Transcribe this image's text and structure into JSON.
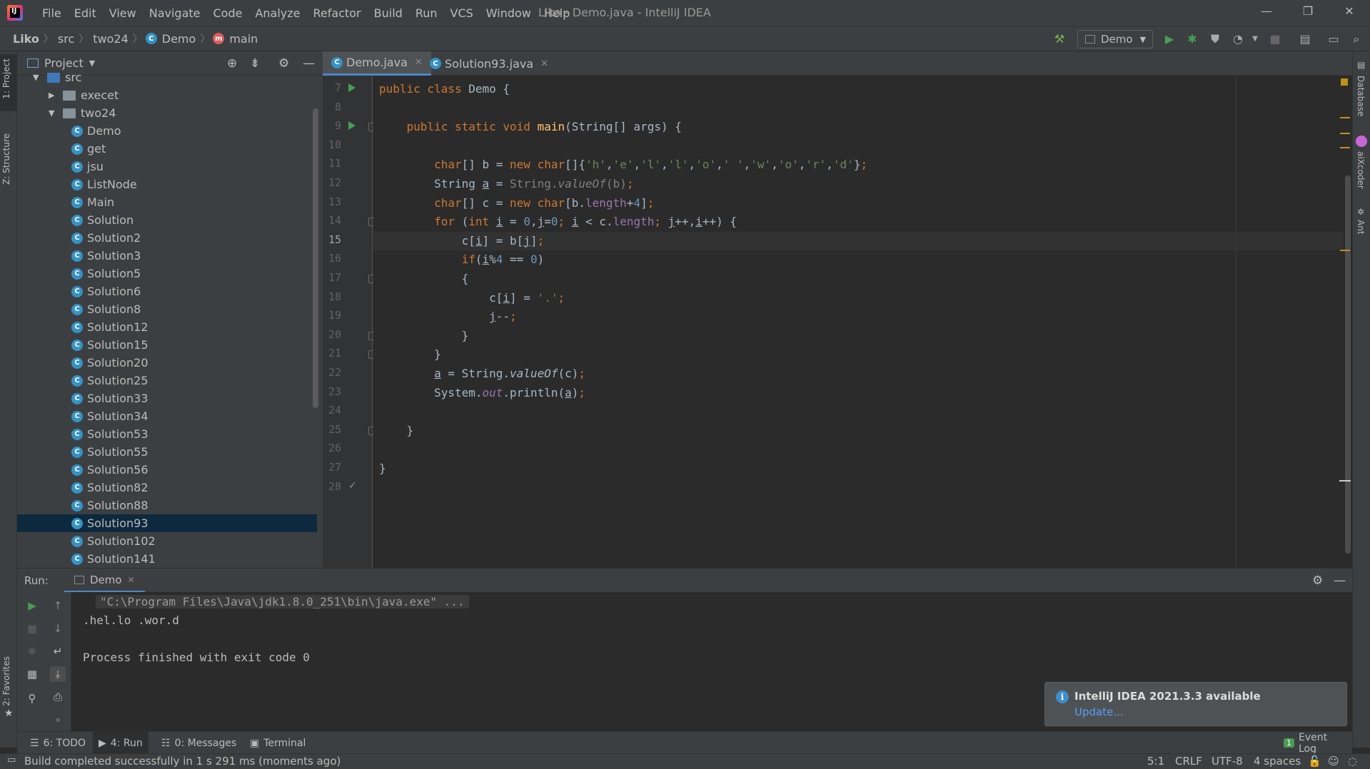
{
  "window": {
    "title": "Liko - Demo.java - IntelliJ IDEA",
    "menus": [
      "File",
      "Edit",
      "View",
      "Navigate",
      "Code",
      "Analyze",
      "Refactor",
      "Build",
      "Run",
      "VCS",
      "Window",
      "Help"
    ]
  },
  "breadcrumb": {
    "project": "Liko",
    "src": "src",
    "package": "two24",
    "class": "Demo",
    "method": "main"
  },
  "toolbar": {
    "run_config": "Demo"
  },
  "left_strip": {
    "project_tab": "1: Project",
    "structure_tab": "Z: Structure",
    "favorites_tab": "2: Favorites"
  },
  "right_strip": {
    "database_tab": "Database",
    "aixcoder_tab": "aiXcoder",
    "ant_tab": "Ant"
  },
  "project_panel": {
    "title": "Project",
    "tree": [
      {
        "label": "src",
        "kind": "src-folder",
        "depth": 0,
        "arrow": "▼"
      },
      {
        "label": "execet",
        "kind": "package",
        "depth": 1,
        "arrow": "▶"
      },
      {
        "label": "two24",
        "kind": "package",
        "depth": 1,
        "arrow": "▼"
      },
      {
        "label": "Demo",
        "kind": "class-main",
        "depth": 2
      },
      {
        "label": "get",
        "kind": "class-main",
        "depth": 2
      },
      {
        "label": "jsu",
        "kind": "class-main",
        "depth": 2
      },
      {
        "label": "ListNode",
        "kind": "class",
        "depth": 2
      },
      {
        "label": "Main",
        "kind": "class-main",
        "depth": 2
      },
      {
        "label": "Solution",
        "kind": "class",
        "depth": 2
      },
      {
        "label": "Solution2",
        "kind": "class",
        "depth": 2
      },
      {
        "label": "Solution3",
        "kind": "class",
        "depth": 2
      },
      {
        "label": "Solution5",
        "kind": "class",
        "depth": 2
      },
      {
        "label": "Solution6",
        "kind": "class",
        "depth": 2
      },
      {
        "label": "Solution8",
        "kind": "class",
        "depth": 2
      },
      {
        "label": "Solution12",
        "kind": "class",
        "depth": 2
      },
      {
        "label": "Solution15",
        "kind": "class",
        "depth": 2
      },
      {
        "label": "Solution20",
        "kind": "class",
        "depth": 2
      },
      {
        "label": "Solution25",
        "kind": "class",
        "depth": 2
      },
      {
        "label": "Solution33",
        "kind": "class",
        "depth": 2
      },
      {
        "label": "Solution34",
        "kind": "class",
        "depth": 2
      },
      {
        "label": "Solution53",
        "kind": "class",
        "depth": 2
      },
      {
        "label": "Solution55",
        "kind": "class",
        "depth": 2
      },
      {
        "label": "Solution56",
        "kind": "class",
        "depth": 2
      },
      {
        "label": "Solution82",
        "kind": "class",
        "depth": 2
      },
      {
        "label": "Solution88",
        "kind": "class",
        "depth": 2
      },
      {
        "label": "Solution93",
        "kind": "class",
        "depth": 2,
        "selected": true
      },
      {
        "label": "Solution102",
        "kind": "class",
        "depth": 2
      },
      {
        "label": "Solution141",
        "kind": "class",
        "depth": 2
      }
    ]
  },
  "editor": {
    "tabs": [
      {
        "label": "Demo.java",
        "active": true
      },
      {
        "label": "Solution93.java",
        "active": false
      }
    ],
    "current_line": 15,
    "lines": [
      {
        "n": "7",
        "html": "<span class=\"kw\">public class </span>Demo {"
      },
      {
        "n": "8",
        "html": ""
      },
      {
        "n": "9",
        "html": "    <span class=\"kw\">public static void </span><span class=\"fn\">main</span>(String[] args) {"
      },
      {
        "n": "10",
        "html": ""
      },
      {
        "n": "11",
        "html": "        <span class=\"kw\">char</span>[] b = <span class=\"kw\">new char</span>[]{<span class=\"str\">'h'</span>,<span class=\"str\">'e'</span>,<span class=\"str\">'l'</span>,<span class=\"str\">'l'</span>,<span class=\"str\">'o'</span>,<span class=\"str\">' '</span>,<span class=\"str\">'w'</span>,<span class=\"str\">'o'</span>,<span class=\"str\">'r'</span>,<span class=\"str\">'d'</span>}<span class=\"kw\">;</span>"
      },
      {
        "n": "12",
        "html": "        String <span class=\"ul\">a</span> = <span class=\"gray\">String.<span class=\"ital\">valueOf</span>(b)</span><span class=\"kw\">;</span>"
      },
      {
        "n": "13",
        "html": "        <span class=\"kw\">char</span>[] c = <span class=\"kw\">new char</span>[b.<span class=\"fld\">length</span>+<span class=\"num\">4</span>]<span class=\"kw\">;</span>"
      },
      {
        "n": "14",
        "html": "        <span class=\"kw\">for </span>(<span class=\"kw\">int </span><span class=\"ul\">i</span> = <span class=\"num\">0</span>,<span class=\"ul\">j</span>=<span class=\"num\">0</span><span class=\"kw\">; </span><span class=\"ul\">i</span> &lt; c.<span class=\"fld\">length</span><span class=\"kw\">; </span><span class=\"ul\">j</span>++,<span class=\"ul\">i</span>++) {"
      },
      {
        "n": "15",
        "html": "            c[<span class=\"ul\">i</span>] = b[<span class=\"ul\">j</span>]<span class=\"kw\">;</span>"
      },
      {
        "n": "16",
        "html": "            <span class=\"kw\">if</span>(<span class=\"ul\">i</span>%<span class=\"num\">4 </span>== <span class=\"num\">0</span>)"
      },
      {
        "n": "17",
        "html": "            {"
      },
      {
        "n": "18",
        "html": "                c[<span class=\"ul\">i</span>] = <span class=\"str\">'.'</span><span class=\"kw\">;</span>"
      },
      {
        "n": "19",
        "html": "                <span class=\"ul\">j</span>--<span class=\"kw\">;</span>"
      },
      {
        "n": "20",
        "html": "            }"
      },
      {
        "n": "21",
        "html": "        }"
      },
      {
        "n": "22",
        "html": "        <span class=\"ul\">a</span> = String.<span class=\"ital\">valueOf</span>(c)<span class=\"kw\">;</span>"
      },
      {
        "n": "23",
        "html": "        System.<span class=\"fld ital\">out</span>.println(<span class=\"ul\">a</span>)<span class=\"kw\">;</span>"
      },
      {
        "n": "24",
        "html": ""
      },
      {
        "n": "25",
        "html": "    }"
      },
      {
        "n": "26",
        "html": ""
      },
      {
        "n": "27",
        "html": "}"
      },
      {
        "n": "28",
        "html": ""
      }
    ]
  },
  "run_panel": {
    "label": "Run:",
    "tab": "Demo",
    "command": "\"C:\\Program Files\\Java\\jdk1.8.0_251\\bin\\java.exe\" ...",
    "output": ".hel.lo .wor.d",
    "finished": "Process finished with exit code 0"
  },
  "notification": {
    "title": "IntelliJ IDEA 2021.3.3 available",
    "link": "Update..."
  },
  "bottom_tabs": [
    {
      "label": "6: TODO",
      "icon": "todo-icon"
    },
    {
      "label": "4: Run",
      "icon": "run-icon",
      "active": true
    },
    {
      "label": "0: Messages",
      "icon": "messages-icon"
    },
    {
      "label": "Terminal",
      "icon": "terminal-icon"
    }
  ],
  "event_log": {
    "count": "1",
    "label": "Event Log"
  },
  "status": {
    "message": "Build completed successfully in 1 s 291 ms (moments ago)",
    "position": "5:1",
    "line_sep": "CRLF",
    "encoding": "UTF-8",
    "indent": "4 spaces"
  },
  "colors": {
    "accent": "#4a88c7",
    "selection": "#0d293e",
    "keyword": "#cc7832",
    "number": "#6897bb",
    "string": "#6a8759"
  }
}
